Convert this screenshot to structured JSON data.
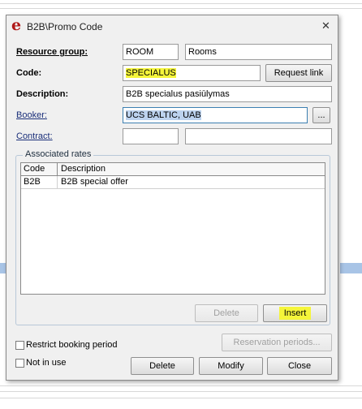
{
  "window": {
    "logo": "e",
    "title": "B2B\\Promo Code",
    "close_glyph": "✕"
  },
  "form": {
    "resource_group": {
      "label": "Resource group:",
      "code": "ROOM",
      "name": "Rooms"
    },
    "code": {
      "label": "Code:",
      "value": "SPECIALUS",
      "request_link_label": "Request link"
    },
    "description": {
      "label": "Description:",
      "value": "B2B specialus pasiūlymas"
    },
    "booker": {
      "label": "Booker:",
      "value": "UCS BALTIC, UAB",
      "browse_label": "..."
    },
    "contract": {
      "label": "Contract:",
      "code": "",
      "name": ""
    }
  },
  "associated_rates": {
    "title": "Associated rates",
    "columns": [
      "Code",
      "Description"
    ],
    "rows": [
      {
        "code": "B2B",
        "description": "B2B special offer"
      }
    ],
    "delete_label": "Delete",
    "insert_label": "Insert"
  },
  "options": {
    "restrict_booking_period": {
      "label": "Restrict booking period",
      "checked": false
    },
    "not_in_use": {
      "label": "Not in use",
      "checked": false
    },
    "reservation_periods_label": "Reservation periods..."
  },
  "footer": {
    "delete_label": "Delete",
    "modify_label": "Modify",
    "close_label": "Close"
  },
  "colors": {
    "highlight": "#f5f53a",
    "selection": "#bcd2ee",
    "logo": "#b01818"
  }
}
